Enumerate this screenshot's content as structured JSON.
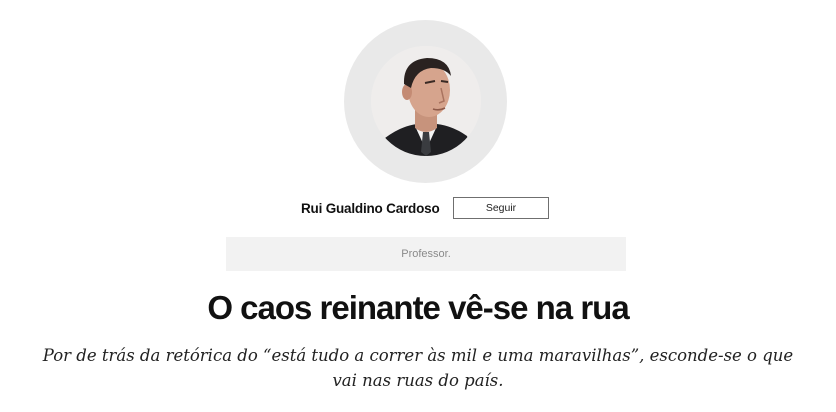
{
  "author": {
    "name": "Rui Gualdino Cardoso",
    "follow_label": "Seguir",
    "bio": "Professor."
  },
  "article": {
    "title": "O caos reinante vê-se na rua",
    "lead": "Por de trás da retórica do “está tudo a correr às mil e uma maravilhas”, esconde-se o que vai nas ruas do país."
  },
  "colors": {
    "avatar_ring": "#e9e9e9",
    "bio_background": "#f2f2f2",
    "bio_text": "#8a8a8a",
    "button_border": "#6f6f6f"
  }
}
